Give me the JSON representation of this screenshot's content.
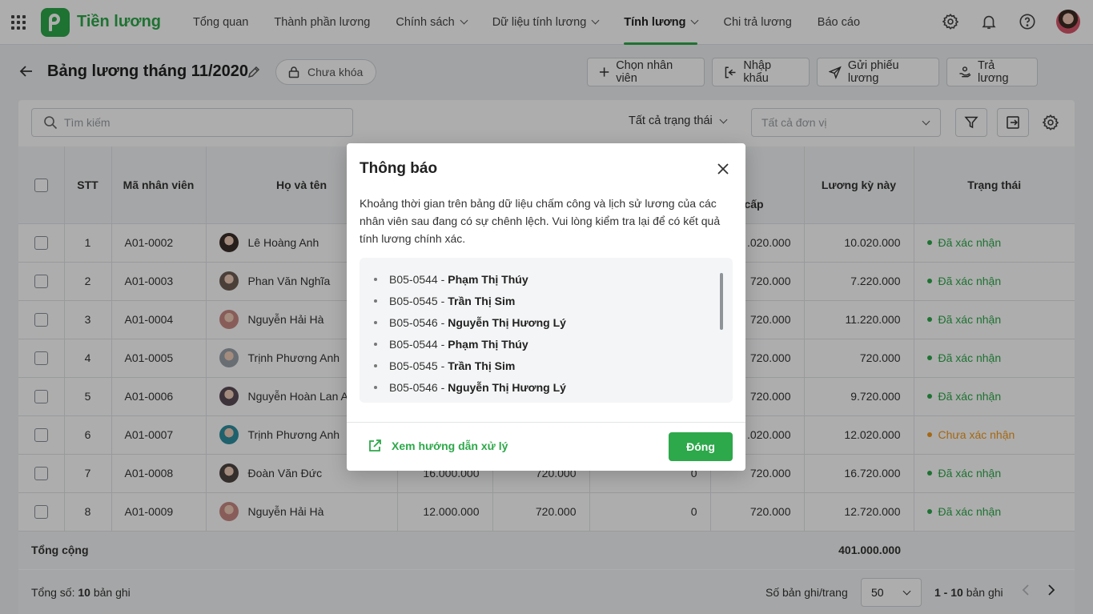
{
  "app": {
    "name": "Tiền lương"
  },
  "nav": [
    {
      "label": "Tổng quan",
      "has_dropdown": false,
      "active": false
    },
    {
      "label": "Thành phần lương",
      "has_dropdown": false,
      "active": false
    },
    {
      "label": "Chính sách",
      "has_dropdown": true,
      "active": false
    },
    {
      "label": "Dữ liệu tính lương",
      "has_dropdown": true,
      "active": false
    },
    {
      "label": "Tính lương",
      "has_dropdown": true,
      "active": true
    },
    {
      "label": "Chi trả lương",
      "has_dropdown": false,
      "active": false
    },
    {
      "label": "Báo cáo",
      "has_dropdown": false,
      "active": false
    }
  ],
  "page": {
    "title": "Bảng lương tháng 11/2020",
    "lock_status": "Chưa khóa",
    "actions": {
      "choose_employee": "Chọn nhân viên",
      "import": "Nhập khẩu",
      "send_payslip": "Gửi phiếu lương",
      "pay": "Trả lương"
    }
  },
  "filters": {
    "search_placeholder": "Tìm kiếm",
    "status": "Tất cả trạng thái",
    "unit_placeholder": "Tất cả đơn vị"
  },
  "table": {
    "headers": {
      "index": "STT",
      "code": "Mã nhân viên",
      "name": "Họ và tên",
      "allowance_partial": "g phụ cấp",
      "net_salary": "Lương kỳ này",
      "status": "Trạng thái"
    },
    "rows": [
      {
        "index": "1",
        "code": "A01-0002",
        "name": "Lê Hoàng Anh",
        "c1": "",
        "c2": "",
        "c3": "",
        "allowance": ".020.000",
        "net": "10.020.000",
        "status": "Đã xác nhận",
        "confirmed": true
      },
      {
        "index": "2",
        "code": "A01-0003",
        "name": "Phan Văn Nghĩa",
        "c1": "",
        "c2": "",
        "c3": "",
        "allowance": "720.000",
        "net": "7.220.000",
        "status": "Đã xác nhận",
        "confirmed": true
      },
      {
        "index": "3",
        "code": "A01-0004",
        "name": "Nguyễn Hải Hà",
        "c1": "",
        "c2": "",
        "c3": "",
        "allowance": "720.000",
        "net": "11.220.000",
        "status": "Đã xác nhận",
        "confirmed": true
      },
      {
        "index": "4",
        "code": "A01-0005",
        "name": "Trịnh Phương Anh",
        "c1": "",
        "c2": "",
        "c3": "",
        "allowance": "720.000",
        "net": "720.000",
        "status": "Đã xác nhận",
        "confirmed": true
      },
      {
        "index": "5",
        "code": "A01-0006",
        "name": "Nguyễn Hoàn Lan A",
        "c1": "",
        "c2": "",
        "c3": "",
        "allowance": "720.000",
        "net": "9.720.000",
        "status": "Đã xác nhận",
        "confirmed": true
      },
      {
        "index": "6",
        "code": "A01-0007",
        "name": "Trịnh Phương Anh",
        "c1": "",
        "c2": "",
        "c3": "",
        "allowance": ".020.000",
        "net": "12.020.000",
        "status": "Chưa xác nhận",
        "confirmed": false
      },
      {
        "index": "7",
        "code": "A01-0008",
        "name": "Đoàn Văn Đức",
        "c1": "16.000.000",
        "c2": "720.000",
        "c3": "0",
        "allowance": "720.000",
        "net": "16.720.000",
        "status": "Đã xác nhận",
        "confirmed": true
      },
      {
        "index": "8",
        "code": "A01-0009",
        "name": "Nguyễn Hải Hà",
        "c1": "12.000.000",
        "c2": "720.000",
        "c3": "0",
        "allowance": "720.000",
        "net": "12.720.000",
        "status": "Đã xác nhận",
        "confirmed": true
      }
    ],
    "total_label": "Tổng cộng",
    "total_value": "401.000.000"
  },
  "footer": {
    "total_prefix": "Tổng số:",
    "total_count": "10",
    "total_suffix": "bản ghi",
    "per_page_label": "Số bản ghi/trang",
    "per_page_value": "50",
    "range": "1 - 10",
    "range_suffix": "bản ghi"
  },
  "modal": {
    "title": "Thông báo",
    "description": "Khoảng thời gian trên bảng dữ liệu chấm công và lịch sử lương của các nhân viên sau đang có sự chênh lệch. Vui lòng kiểm tra lại để có kết quả tính lương chính xác.",
    "employees": [
      {
        "code": "B05-0544 -",
        "name": "Phạm Thị Thúy"
      },
      {
        "code": "B05-0545 -",
        "name": "Trần Thị Sim"
      },
      {
        "code": "B05-0546 -",
        "name": "Nguyễn Thị Hương Lý"
      },
      {
        "code": "B05-0544 -",
        "name": "Phạm Thị Thúy"
      },
      {
        "code": "B05-0545 -",
        "name": "Trần Thị Sim"
      },
      {
        "code": "B05-0546 -",
        "name": "Nguyễn Thị Hương Lý"
      }
    ],
    "guide_link": "Xem hướng dẫn xử lý",
    "close_button": "Đóng"
  },
  "colors": {
    "brand": "#2da84a",
    "pending": "#f29a1d"
  }
}
